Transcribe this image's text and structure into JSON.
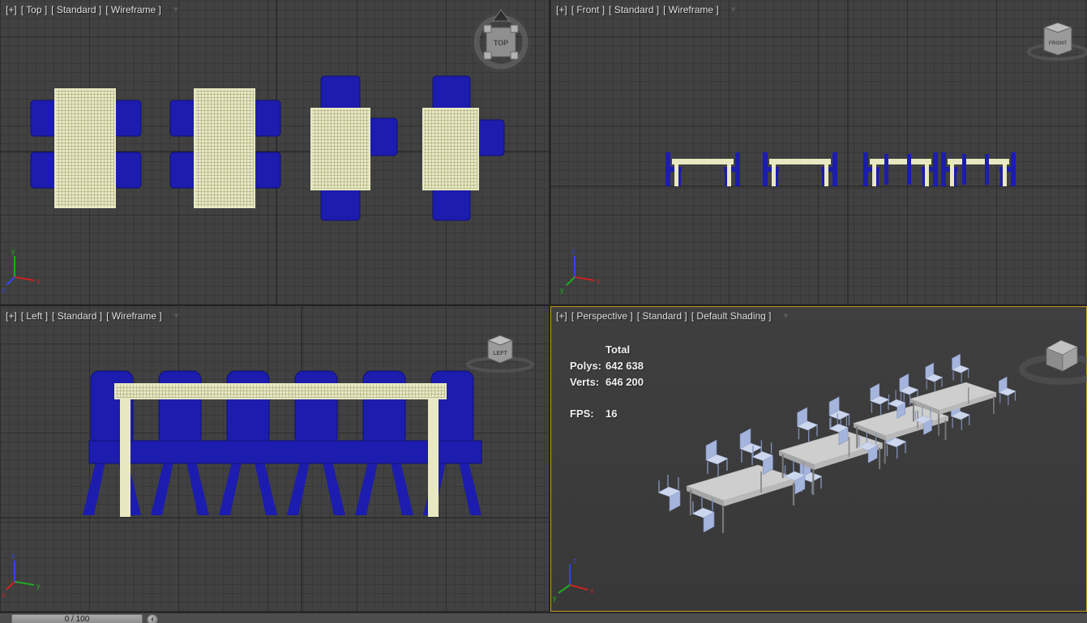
{
  "colors": {
    "viewport_bg": "#414141",
    "grid_minor": "#383838",
    "grid_major": "#2e2e2e",
    "active_viewport_border": "#c79a1d",
    "table_wireframe": "#e8e8c2",
    "chair_wireframe": "#1c1cae",
    "shaded_table": "#cecece",
    "shaded_chair": "#a4b4dc",
    "axis_x": "#cc2222",
    "axis_y": "#22aa22",
    "axis_z": "#3344ee"
  },
  "icons": {
    "viewport_menu_dropdown": "▼",
    "timeline_next_arrow": "‹"
  },
  "axis_gizmo": {
    "x_label": "x",
    "y_label": "y",
    "z_label": "z"
  },
  "viewports": {
    "top": {
      "general_menu": "[+]",
      "point_of_view": "[ Top ]",
      "render_preset": "[ Standard ]",
      "shading": "[ Wireframe ]",
      "viewcube_face": "TOP"
    },
    "front": {
      "general_menu": "[+]",
      "point_of_view": "[ Front ]",
      "render_preset": "[ Standard ]",
      "shading": "[ Wireframe ]",
      "viewcube_face": "FRONT"
    },
    "left": {
      "general_menu": "[+]",
      "point_of_view": "[ Left ]",
      "render_preset": "[ Standard ]",
      "shading": "[ Wireframe ]",
      "viewcube_face": "LEFT"
    },
    "perspective": {
      "general_menu": "[+]",
      "point_of_view": "[ Perspective ]",
      "render_preset": "[ Standard ]",
      "shading": "[ Default Shading ]",
      "stats": {
        "total_label": "Total",
        "polys_label": "Polys:",
        "polys_value": "642 638",
        "verts_label": "Verts:",
        "verts_value": "646 200",
        "fps_label": "FPS:",
        "fps_value": "16"
      }
    }
  },
  "timeline": {
    "handle_label": "0 / 100"
  }
}
